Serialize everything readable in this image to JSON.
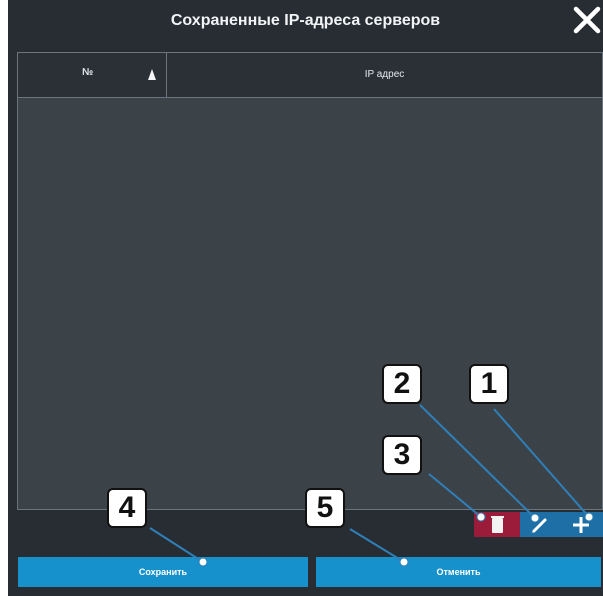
{
  "dialog": {
    "title": "Сохраненные IP-адреса серверов",
    "close_icon": "close-icon"
  },
  "table": {
    "columns": [
      {
        "label": "№",
        "sort": "ascending"
      },
      {
        "label": "IP адрес"
      }
    ],
    "rows": []
  },
  "toolbar": {
    "delete_icon": "trash-icon",
    "edit_icon": "pencil-icon",
    "add_icon": "plus-icon",
    "delete_color": "#9b1c3a",
    "accent_color": "#1e6fa6"
  },
  "footer": {
    "save_label": "Сохранить",
    "cancel_label": "Отменить",
    "button_color": "#1691cc"
  },
  "callouts": [
    {
      "number": "1",
      "target": "add-button"
    },
    {
      "number": "2",
      "target": "edit-button"
    },
    {
      "number": "3",
      "target": "delete-button"
    },
    {
      "number": "4",
      "target": "save-button"
    },
    {
      "number": "5",
      "target": "cancel-button"
    }
  ]
}
